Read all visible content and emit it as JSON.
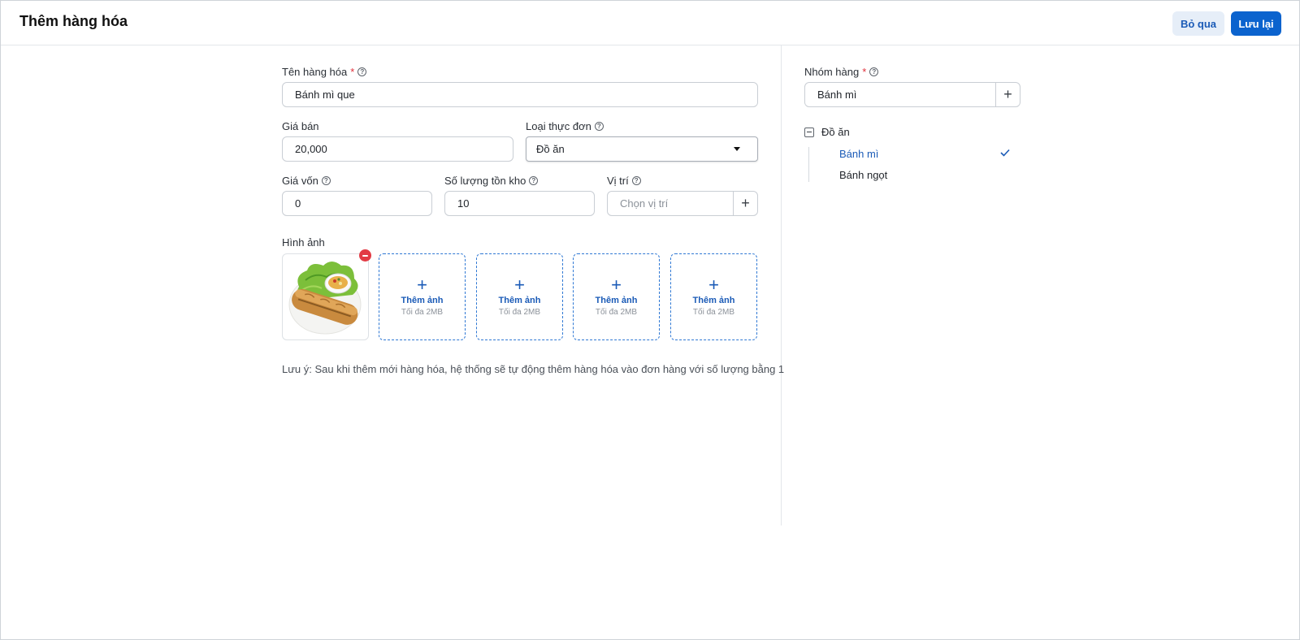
{
  "header": {
    "title": "Thêm hàng hóa",
    "skip_label": "Bỏ qua",
    "save_label": "Lưu lại"
  },
  "form": {
    "name": {
      "label": "Tên hàng hóa",
      "required_mark": "*",
      "value": "Bánh mì que"
    },
    "price": {
      "label": "Giá bán",
      "value": "20,000"
    },
    "menu_type": {
      "label": "Loại thực đơn",
      "value": "Đồ ăn"
    },
    "cost": {
      "label": "Giá vốn",
      "value": "0"
    },
    "stock": {
      "label": "Số lượng tồn kho",
      "value": "10"
    },
    "location": {
      "label": "Vị trí",
      "placeholder": "Chọn vị trí",
      "add_label": "+"
    },
    "images": {
      "label": "Hình ảnh",
      "add_label": "Thêm ảnh",
      "max_size": "Tối đa 2MB",
      "filled_count": 1,
      "slots": 5
    },
    "note": "Lưu ý: Sau khi thêm mới hàng hóa, hệ thống sẽ tự động thêm hàng hóa vào đơn hàng với số lượng bằng 1"
  },
  "group": {
    "label": "Nhóm hàng",
    "required_mark": "*",
    "value": "Bánh mì",
    "add_label": "+",
    "tree": {
      "root": "Đồ ăn",
      "children": [
        {
          "label": "Bánh mì",
          "selected": true
        },
        {
          "label": "Bánh ngọt",
          "selected": false
        }
      ]
    }
  },
  "icons": {
    "help": "question-circle-icon",
    "caret": "caret-down-icon",
    "remove": "minus-circle-icon",
    "check": "check-icon",
    "collapse": "minus-square-icon"
  },
  "colors": {
    "primary": "#0b63ce",
    "primary_light": "#e6eef8",
    "danger": "#e23b45",
    "border": "#c9ced4"
  }
}
